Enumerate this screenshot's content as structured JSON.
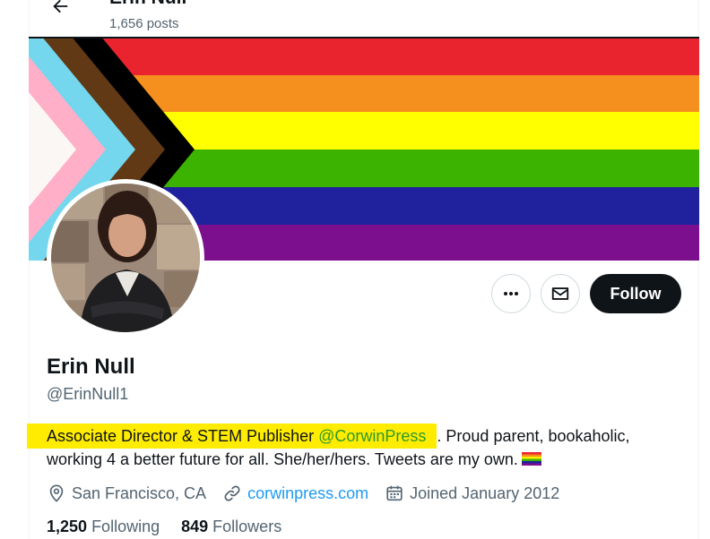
{
  "header": {
    "name": "Erin Null",
    "posts": "1,656 posts"
  },
  "banner": {
    "description_colors": [
      "#e9242f",
      "#f5901e",
      "#ffff00",
      "#3cb300",
      "#1f229c",
      "#7c0f8e"
    ]
  },
  "actions": {
    "more_icon": "more-dots-icon",
    "message_icon": "envelope-icon",
    "follow_label": "Follow"
  },
  "profile": {
    "display_name": "Erin Null",
    "handle": "@ErinNull1",
    "bio_highlight": "Associate Director & STEM Publisher ",
    "bio_mention": "@CorwinPress",
    "bio_rest": ". Proud parent, bookaholic, working 4 a better future for all. She/her/hers. Tweets are my own.",
    "location": "San Francisco, CA",
    "website": "corwinpress.com",
    "joined": "Joined January 2012"
  },
  "stats": {
    "following_count": "1,250",
    "following_label": "Following",
    "followers_count": "849",
    "followers_label": "Followers"
  },
  "colors": {
    "accent": "#1d9bf0",
    "highlight": "#ffec00",
    "button_dark": "#0f1419"
  }
}
